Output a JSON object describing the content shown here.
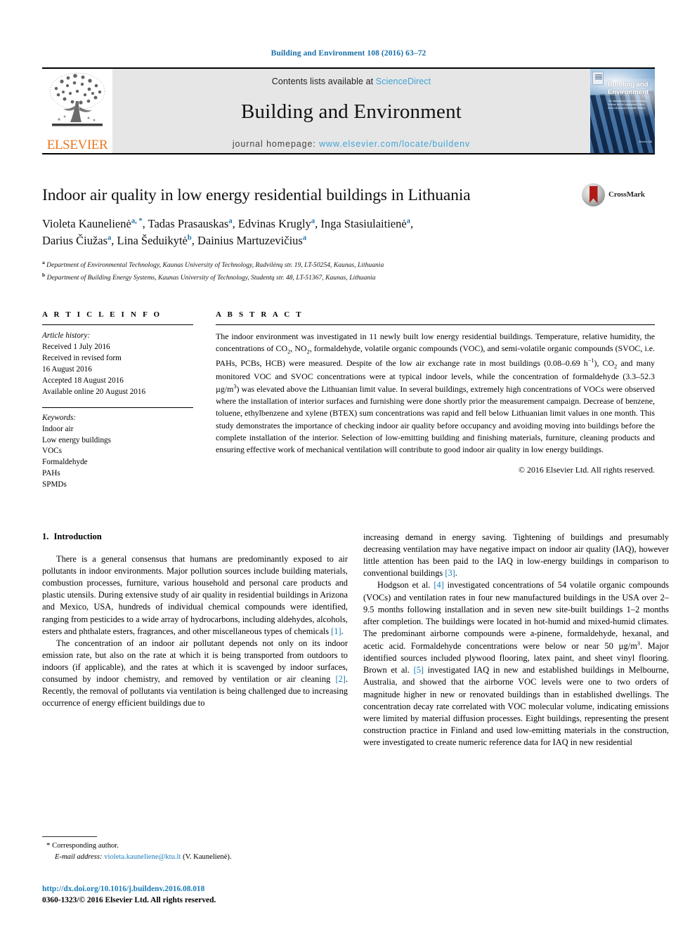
{
  "running_head": "Building and Environment 108 (2016) 63–72",
  "banner": {
    "publisher": "ELSEVIER",
    "contents_prefix": "Contents lists available at ",
    "sciencedirect": "ScienceDirect",
    "journal_name": "Building and Environment",
    "homepage_label": "journal homepage: ",
    "homepage_url": "www.elsevier.com/locate/buildenv",
    "cover_title": "Building and Environment",
    "cover_subtitle": "The International Journal of Building Science and its Applications\nEditor: Shuzo Murakami\nAssociate Editors:",
    "cover_corner": "Volume 108"
  },
  "crossmark": {
    "label": "CrossMark"
  },
  "article": {
    "title": "Indoor air quality in low energy residential buildings in Lithuania",
    "authors": [
      {
        "name": "Violeta Kaunelienė",
        "marks": "a, *"
      },
      {
        "name": "Tadas Prasauskas",
        "marks": "a"
      },
      {
        "name": "Edvinas Krugly",
        "marks": "a"
      },
      {
        "name": "Inga Stasiulaitienė",
        "marks": "a"
      },
      {
        "name": "Darius Čiužas",
        "marks": "a"
      },
      {
        "name": "Lina Šeduikytė",
        "marks": "b"
      },
      {
        "name": "Dainius Martuzevičius",
        "marks": "a"
      }
    ],
    "affiliations": [
      {
        "mark": "a",
        "text": "Department of Environmental Technology, Kaunas University of Technology, Radvilėnų str. 19, LT-50254, Kaunas, Lithuania"
      },
      {
        "mark": "b",
        "text": "Department of Building Energy Systems, Kaunas University of Technology, Studentų str. 48, LT-51367, Kaunas, Lithuania"
      }
    ]
  },
  "article_info": {
    "heading": "A R T I C L E  I N F O",
    "history_title": "Article history:",
    "history": [
      "Received 1 July 2016",
      "Received in revised form",
      "16 August 2016",
      "Accepted 18 August 2016",
      "Available online 20 August 2016"
    ],
    "keywords_title": "Keywords:",
    "keywords": [
      "Indoor air",
      "Low energy buildings",
      "VOCs",
      "Formaldehyde",
      "PAHs",
      "SPMDs"
    ]
  },
  "abstract": {
    "heading": "A B S T R A C T",
    "part1": "The indoor environment was investigated in 11 newly built low energy residential buildings. Temperature, relative humidity, the concentrations of CO",
    "part2": ", NO",
    "part3": ", formaldehyde, volatile organic compounds (VOC), and semi-volatile organic compounds (SVOC, i.e. PAHs, PCBs, HCB) were measured. Despite of the low air exchange rate in most buildings (0.08–0.69 h",
    "part4": "), CO",
    "part5": " and many monitored VOC and SVOC concentrations were at typical indoor levels, while the concentration of formaldehyde (3.3–52.3 µg/m",
    "part6": ") was elevated above the Lithuanian limit value. In several buildings, extremely high concentrations of VOCs were observed where the installation of interior surfaces and furnishing were done shortly prior the measurement campaign. Decrease of benzene, toluene, ethylbenzene and xylene (BTEX) sum concentrations was rapid and fell below Lithuanian limit values in one month. This study demonstrates the importance of checking indoor air quality before occupancy and avoiding moving into buildings before the complete installation of the interior. Selection of low-emitting building and finishing materials, furniture, cleaning products and ensuring effective work of mechanical ventilation will contribute to good indoor air quality in low energy buildings.",
    "sub_co2_a": "2",
    "sub_no2": "2",
    "sup_h": "−1",
    "sub_co2_b": "2",
    "sup_m3": "3",
    "copyright": "© 2016 Elsevier Ltd. All rights reserved."
  },
  "introduction": {
    "number": "1.",
    "title": "Introduction",
    "left_paragraphs": [
      {
        "pre": "There is a general consensus that humans are predominantly exposed to air pollutants in indoor environments. Major pollution sources include building materials, combustion processes, furniture, various household and personal care products and plastic utensils. During extensive study of air quality in residential buildings in Arizona and Mexico, USA, hundreds of individual chemical compounds were identified, ranging from pesticides to a wide array of hydrocarbons, including aldehydes, alcohols, esters and phthalate esters, fragrances, and other miscellaneous types of chemicals ",
        "ref": "[1]",
        "post": "."
      },
      {
        "pre": "The concentration of an indoor air pollutant depends not only on its indoor emission rate, but also on the rate at which it is being transported from outdoors to indoors (if applicable), and the rates at which it is scavenged by indoor surfaces, consumed by indoor chemistry, and removed by ventilation or air cleaning ",
        "ref": "[2]",
        "post": ". Recently, the removal of pollutants via ventilation is being challenged due to increasing occurrence of energy efficient buildings due to"
      }
    ],
    "right_paragraphs": [
      {
        "pre": "increasing demand in energy saving. Tightening of buildings and presumably decreasing ventilation may have negative impact on indoor air quality (IAQ), however little attention has been paid to the IAQ in low-energy buildings in comparison to conventional buildings ",
        "ref": "[3]",
        "post": "."
      },
      {
        "pre": "Hodgson et al. ",
        "ref": "[4]",
        "post": " investigated concentrations of 54 volatile organic compounds (VOCs) and ventilation rates in four new manufactured buildings in the USA over 2–9.5 months following installation and in seven new site-built buildings 1–2 months after completion. The buildings were located in hot-humid and mixed-humid climates. The predominant airborne compounds were a-pinene, formaldehyde, hexanal, and acetic acid. Formaldehyde concentrations were below or near 50 µg/m",
        "post_sup": "3",
        "post2_pre": ". Major identified sources included plywood flooring, latex paint, and sheet vinyl flooring. Brown et al. ",
        "ref2": "[5]",
        "post2": " investigated IAQ in new and established buildings in Melbourne, Australia, and showed that the airborne VOC levels were one to two orders of magnitude higher in new or renovated buildings than in established dwellings. The concentration decay rate correlated with VOC molecular volume, indicating emissions were limited by material diffusion processes. Eight buildings, representing the present construction practice in Finland and used low-emitting materials in the construction, were investigated to create numeric reference data for IAQ in new residential"
      }
    ]
  },
  "footnote": {
    "star": "*",
    "corresponding": "Corresponding author.",
    "email_label": "E-mail address:",
    "email": "violeta.kauneliene@ktu.lt",
    "email_owner": "(V. Kaunelienė)."
  },
  "page_footer": {
    "doi": "http://dx.doi.org/10.1016/j.buildenv.2016.08.018",
    "issn": "0360-1323/© 2016 Elsevier Ltd. All rights reserved."
  },
  "colors": {
    "link": "#1a7cb8",
    "header_blue": "#1a6fa8",
    "sciencedirect": "#41a4d8",
    "elsevier_orange": "#E87722",
    "banner_bg": "#e6e6e6"
  }
}
